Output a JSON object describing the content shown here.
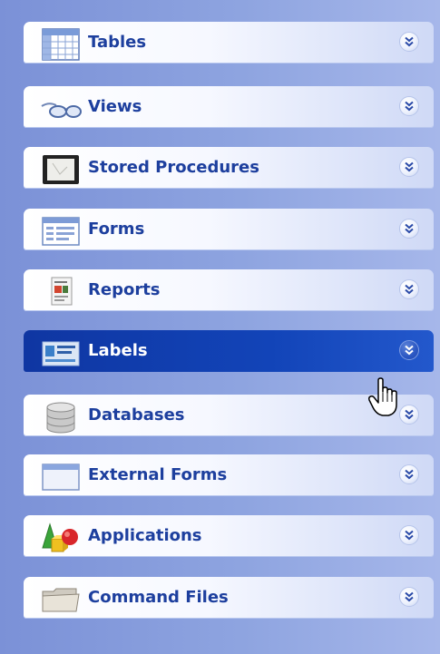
{
  "nav_groups": [
    {
      "label": "Tables",
      "icon": "table-icon"
    },
    {
      "label": "Views",
      "icon": "glasses-icon"
    },
    {
      "label": "Stored Procedures",
      "icon": "procedure-icon"
    },
    {
      "label": "Forms",
      "icon": "form-icon"
    },
    {
      "label": "Reports",
      "icon": "report-icon"
    },
    {
      "label": "Labels",
      "icon": "label-icon",
      "state": "selected"
    },
    {
      "label": "Databases",
      "icon": "database-icon"
    },
    {
      "label": "External Forms",
      "icon": "window-icon"
    },
    {
      "label": "Applications",
      "icon": "applications-icon"
    },
    {
      "label": "Command Files",
      "icon": "folder-icon"
    }
  ],
  "colors": {
    "panel": "#8ea4e0",
    "label": "#1d3f9e",
    "selected_background": "#1244b8",
    "selected_label": "#ffffff"
  },
  "cursor": "hand-pointer-icon"
}
